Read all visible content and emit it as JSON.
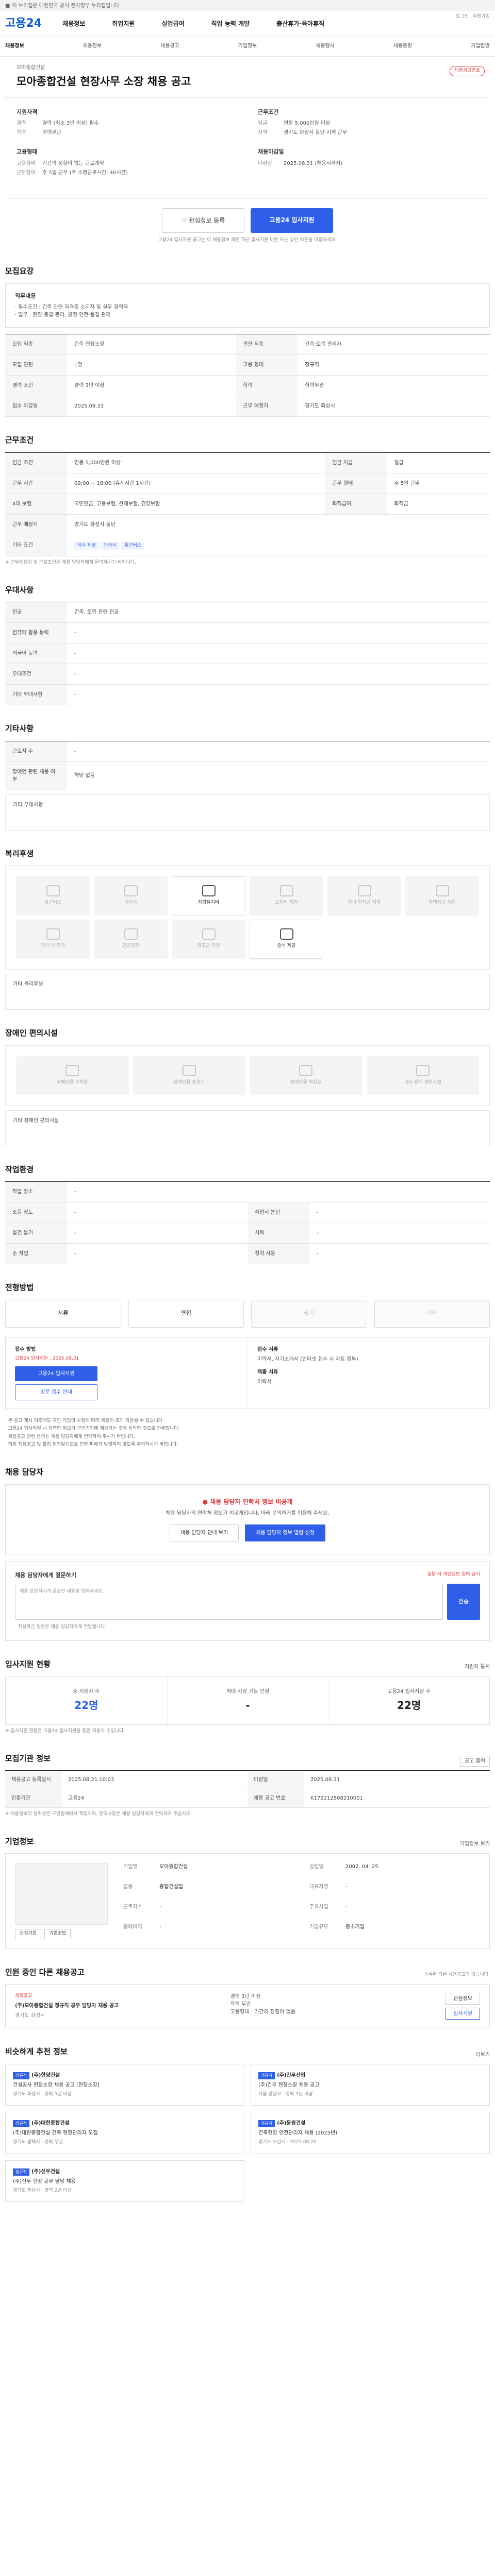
{
  "topbar": {
    "text": "이 누리집은 대한민국 공식 전자정부 누리집입니다."
  },
  "header": {
    "logo": "고용24",
    "gnb": [
      "채용정보",
      "취업지원",
      "실업급여",
      "직업 능력 개발",
      "출산휴가·육아휴직"
    ],
    "util": [
      "로그인",
      "회원가입"
    ]
  },
  "subnav": {
    "items": [
      "채용정보",
      "채용정보",
      "채용공고",
      "기업정보",
      "채용행사",
      "채용동향",
      "기업탐방"
    ],
    "active": "채용정보"
  },
  "job": {
    "company": "모아종합건설",
    "title": "모아종합건설 현장사무 소장 채용 공고",
    "badge": "채용공고번호",
    "left_block1_title": "지원자격",
    "left_block1_rows": [
      [
        "경력",
        "경력 (최소 3년 이상) 필수"
      ],
      [
        "학력",
        "학력무관"
      ]
    ],
    "left_block2_title": "고용형태",
    "left_block2_rows": [
      [
        "고용형태",
        "기간의 정함이 없는 근로계약"
      ],
      [
        "근무형태",
        "주 5일 근무 (주 소정근로시간: 40시간)"
      ]
    ],
    "right_block1_title": "근무조건",
    "right_block1_rows": [
      [
        "임금",
        "연봉 5,000만원 이상"
      ],
      [
        "지역",
        "경기도 화성시 동탄 지역 근무"
      ]
    ],
    "right_block2_title": "채용마감일",
    "right_block2_rows": [
      [
        "마감일",
        "2025.08.31 (채용시까지)"
      ]
    ]
  },
  "actions": {
    "interest": "♡ 관심정보 등록",
    "apply": "고용24 입사지원",
    "note": "고용24 입사지원 공고는 이 채용정보 화면 하단 입사지원 버튼 또는 상단 버튼을 이용하세요."
  },
  "recruit_section": {
    "title": "모집요강",
    "duty_title": "직무내용",
    "duty_text": "· 필수조건 : 건축 관련 자격증 소지자 및 실무 경력자\n· 업무 : 현장 총괄 관리, 공정·안전·품질 관리",
    "rows": [
      [
        "모집 직종",
        "건축 현장소장",
        "관련 직종",
        "건축·토목 관리자"
      ],
      [
        "모집 인원",
        "1명",
        "고용 형태",
        "정규직"
      ],
      [
        "경력 조건",
        "경력 3년 이상",
        "학력",
        "학력무관"
      ],
      [
        "접수 마감일",
        "2025.08.31",
        "근무 예정지",
        "경기도 화성시"
      ]
    ]
  },
  "condition_section": {
    "title": "근무조건",
    "rows": [
      [
        "임금 조건",
        "연봉 5,000만원 이상",
        "임금 지급",
        "월급"
      ],
      [
        "근무 시간",
        "09:00 ~ 18:00 (휴게시간 1시간)",
        "근무 형태",
        "주 5일 근무"
      ],
      [
        "4대 보험",
        "국민연금, 고용보험, 산재보험, 건강보험",
        "퇴직급여",
        "퇴직금"
      ],
      [
        "근무 예정지",
        "경기도 화성시 동탄",
        "",
        ""
      ]
    ],
    "extra": [
      "식사 제공",
      "기숙사",
      "통근버스"
    ],
    "note": "※ 근무예정지 및 근로조건은 채용 담당자에게 문의하시기 바랍니다."
  },
  "pref_section": {
    "title": "우대사항",
    "rows": [
      [
        "전공",
        "건축, 토목 관련 전공"
      ],
      [
        "컴퓨터 활용 능력",
        "-"
      ],
      [
        "외국어 능력",
        "-"
      ],
      [
        "우대조건",
        "-"
      ],
      [
        "기타 우대사항",
        "-"
      ]
    ]
  },
  "etc_section": {
    "title": "기타사항",
    "rows": [
      [
        "근로자 수",
        "-"
      ],
      [
        "장애인 관련 채용 여부",
        "해당 없음"
      ]
    ],
    "note_title": "기타 우대사항"
  },
  "welfare_section": {
    "title": "복리후생",
    "items": [
      {
        "label": "통근버스",
        "on": false
      },
      {
        "label": "기숙사",
        "on": false
      },
      {
        "label": "차량유지비",
        "on": true
      },
      {
        "label": "교육비 지원",
        "on": false
      },
      {
        "label": "자녀 학자금 지원",
        "on": false
      },
      {
        "label": "주택자금 지원",
        "on": false
      },
      {
        "label": "연차 외 휴가",
        "on": false
      },
      {
        "label": "건강검진",
        "on": false
      },
      {
        "label": "경조금 지원",
        "on": false
      },
      {
        "label": "중식 제공",
        "on": true
      }
    ],
    "etc_title": "기타 복리후생"
  },
  "disabled_section": {
    "title": "장애인 편의시설",
    "items": [
      "장애인용 주차장",
      "장애인용 승강기",
      "장애인용 화장실",
      "기타 장애 편의시설"
    ],
    "etc_title": "기타 장애인 편의시설"
  },
  "env_section": {
    "title": "작업환경",
    "rows": [
      [
        "작업 장소",
        "-",
        "",
        ""
      ],
      [
        "소음 정도",
        "-",
        "작업시 분진",
        "-"
      ],
      [
        "물건 들기",
        "-",
        "시력",
        "-"
      ],
      [
        "손 작업",
        "-",
        "청력 사용",
        "-"
      ]
    ]
  },
  "method_section": {
    "title": "전형방법",
    "methods": [
      {
        "label": "서류",
        "on": true
      },
      {
        "label": "면접",
        "on": true
      },
      {
        "label": "필기",
        "on": false
      },
      {
        "label": "기타",
        "on": false
      }
    ],
    "apply_title": "접수 방법",
    "apply_sub": "고용24 입사지원 : 2025.08.31",
    "apply_btn": "고용24 입사지원",
    "apply_btn2": "방문 접수 안내",
    "doc_title": "접수 서류",
    "doc_text": "이력서, 자기소개서 (인터넷 접수 시 자동 첨부)",
    "doc_title2": "제출 서류",
    "doc_value": "이력서",
    "notices": [
      "· 본 공고 게시 이후에도 구인 기업의 사정에 따라 채용이 조기 마감될 수 있습니다.",
      "· 고용24 입사지원 시 입력한 정보가 구인기업에 제공되는 것에 동의한 것으로 간주합니다.",
      "· 채용공고 관련 문의는 채용 담당자에게 연락하여 주시기 바랍니다.",
      "· 허위 채용공고 및 불법 취업알선으로 인한 피해가 발생하지 않도록 주의하시기 바랍니다."
    ]
  },
  "contact_section": {
    "title": "채용 담당자",
    "warn_title": "채용 담당자 연락처 정보 비공개",
    "warn_text": "채용 담당자의 연락처 정보가 비공개입니다. 아래 문의하기를 이용해 주세요.",
    "warn_btn1": "채용 담당자 안내 보기",
    "warn_btn2": "채용 담당자 정보 열람 신청",
    "inq_title": "채용 담당자에게 질문하기",
    "inq_note": "질문 시 개인정보 입력 금지",
    "inq_placeholder": "채용 담당자에게 궁금한 내용을 입력하세요.",
    "inq_send": "전송",
    "inq_notes": "· 작성하신 질문은 채용 담당자에게 전달됩니다."
  },
  "stats_section": {
    "title": "입사지원 현황",
    "more": "지원자 통계",
    "stats": [
      {
        "label": "총 지원자 수",
        "value": "22명"
      },
      {
        "label": "최대 지원 가능 인원",
        "value": "-"
      },
      {
        "label": "고용24 입사지원 수",
        "value": "22명"
      }
    ],
    "note": "※ 입사지원 현황은 고용24 입사지원을 통한 지원자 수입니다."
  },
  "period_section": {
    "title": "모집기관 정보",
    "more": "공고 출력",
    "rows": [
      [
        "채용공고 등록일시",
        "2025.08.21 10:03",
        "마감일",
        "2025.08.31"
      ],
      [
        "인증기관",
        "고용24",
        "채용 공고 번호",
        "K172212508210001"
      ]
    ],
    "note": "※ 채용정보의 정확성은 구인업체에서 책임지며, 문의사항은 채용 담당자에게 연락하여 주십시오."
  },
  "company_section": {
    "title": "기업정보",
    "more": "기업정보 보기",
    "name": "모아종합건설",
    "logo_btn1": "관심기업",
    "logo_btn2": "기업정보",
    "rows": [
      [
        "기업명",
        "모아종합건설"
      ],
      [
        "설립일",
        "2002. 04. 25"
      ],
      [
        "업종",
        "종합건설업"
      ],
      [
        "대표자명",
        "-"
      ],
      [
        "근로자수",
        "-"
      ],
      [
        "주요사업",
        "-"
      ],
      [
        "홈페이지",
        "-"
      ],
      [
        "기업규모",
        "중소기업"
      ]
    ]
  },
  "other_section": {
    "title": "인원 중인 다른 채용공고",
    "note": "등록된 다른 채용공고가 없습니다.",
    "card_badge": "채용공고",
    "card_co": "(주)모아종합건설 정규직 공무 담당자 채용 공고",
    "card_loc": "경기도 화성시",
    "card_items": [
      "경력 3년 이상",
      "학력 무관",
      "고용형태 : 기간의 정함이 없음"
    ],
    "card_btn1": "관심정보",
    "card_btn2": "입사지원"
  },
  "recommend_section": {
    "title": "비슷하게 추천 정보",
    "more": "더보기",
    "cards": [
      {
        "badge": "정규직",
        "co": "(주)한양건설",
        "title": "건설공사 현장소장 채용 공고 [현장소장]",
        "meta": "경기도 화성시 · 경력 5년 이상"
      },
      {
        "badge": "정규직",
        "co": "(주)건우산업",
        "title": "(주)건우 현장소장 채용 공고",
        "meta": "서울 강남구 · 경력 3년 이상"
      },
      {
        "badge": "정규직",
        "co": "(주)대한종합건설",
        "title": "(주)대한종합건설 건축 현장관리자 모집",
        "meta": "경기도 평택시 · 경력 무관"
      },
      {
        "badge": "정규직",
        "co": "(주)동원건설",
        "title": "건축현장 안전관리자 채용 (2025년)",
        "meta": "경기도 오산시 · 2025.08.20"
      },
      {
        "badge": "정규직",
        "co": "(주)신우건설",
        "title": "(주)신우 현장 공무 담당 채용",
        "meta": "경기도 화성시 · 경력 2년 이상"
      }
    ]
  }
}
